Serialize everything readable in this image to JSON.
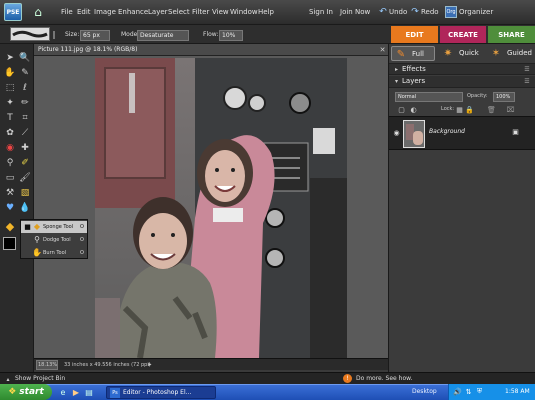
{
  "menubar": {
    "logo_text": "PSE",
    "items": [
      "File",
      "Edit",
      "Image",
      "Enhance",
      "Layer",
      "Select",
      "Filter",
      "View",
      "Window",
      "Help"
    ],
    "right": {
      "sign_in": "Sign In",
      "join_now": "Join Now",
      "undo": "Undo",
      "redo": "Redo",
      "organizer": "Organizer"
    }
  },
  "options": {
    "size_label": "Size:",
    "size_value": "65 px",
    "mode_label": "Mode:",
    "mode_value": "Desaturate",
    "flow_label": "Flow:",
    "flow_value": "10%"
  },
  "tabs": {
    "edit": "EDIT",
    "create": "CREATE",
    "share": "SHARE"
  },
  "colors": {
    "edit": "#e8791e",
    "create": "#b0265a",
    "share": "#4f8e3b"
  },
  "subtabs": {
    "full": "Full",
    "quick": "Quick",
    "guided": "Guided"
  },
  "document": {
    "title": "Picture 111.jpg @ 18.1% (RGB/8)",
    "zoom": "18.13%",
    "doc_info": "33 inches x 49.556 inches (72 ppi)"
  },
  "flyout": {
    "items": [
      {
        "label": "Sponge Tool",
        "key": "O"
      },
      {
        "label": "Dodge Tool",
        "key": "O"
      },
      {
        "label": "Burn Tool",
        "key": "O"
      }
    ]
  },
  "panels": {
    "effects": "Effects",
    "layers": "Layers",
    "blend_mode": "Normal",
    "opacity_label": "Opacity:",
    "opacity_value": "100%",
    "lock_label": "Lock:",
    "layer_name": "Background"
  },
  "bottom": {
    "project_bin": "Show Project Bin",
    "do_more": "Do more. See how."
  },
  "taskbar": {
    "start": "start",
    "app_item": "Editor - Photoshop El...",
    "desktop": "Desktop",
    "time": "1:58 AM"
  },
  "icons": [
    "home-icon",
    "undo-icon",
    "redo-icon",
    "organizer-icon",
    "eye-icon",
    "lock-icon",
    "sponge-icon",
    "dodge-icon",
    "burn-icon"
  ]
}
